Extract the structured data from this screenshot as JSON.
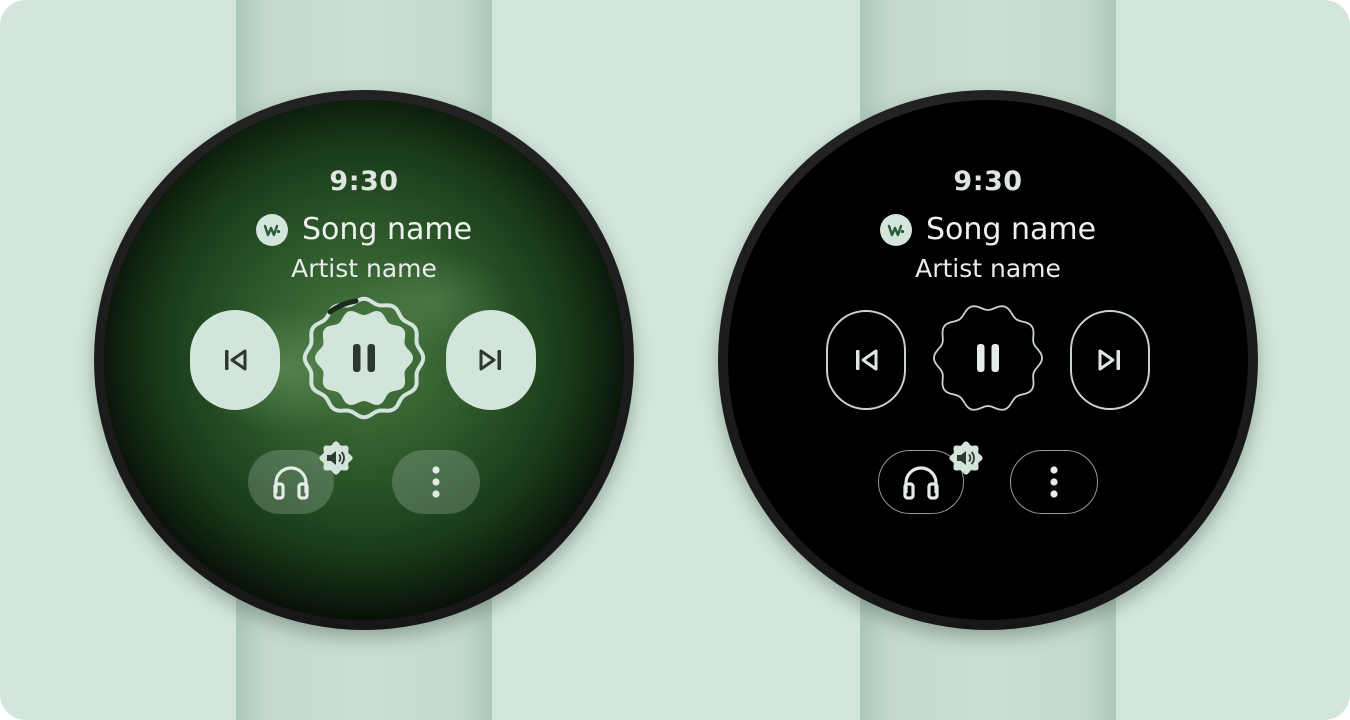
{
  "colors": {
    "background": "#d3e6dc",
    "accent": "#d3e4db",
    "watch_case": "#1e1e1e",
    "screen_glow": "#4a7a43",
    "text": "#eef2ef"
  },
  "watches": [
    {
      "mode": "ambient-color",
      "time": "9:30",
      "song": "Song name",
      "artist": "Artist name",
      "icons": {
        "app": "app-logo-icon",
        "previous": "skip-previous-icon",
        "play_pause": "pause-icon",
        "next": "skip-next-icon",
        "output": "headphones-icon",
        "volume": "volume-icon",
        "more": "more-vert-icon"
      },
      "progress": 0.1
    },
    {
      "mode": "low-power-outline",
      "time": "9:30",
      "song": "Song name",
      "artist": "Artist name",
      "icons": {
        "app": "app-logo-icon",
        "previous": "skip-previous-icon",
        "play_pause": "pause-icon",
        "next": "skip-next-icon",
        "output": "headphones-icon",
        "volume": "volume-icon",
        "more": "more-vert-icon"
      }
    }
  ]
}
